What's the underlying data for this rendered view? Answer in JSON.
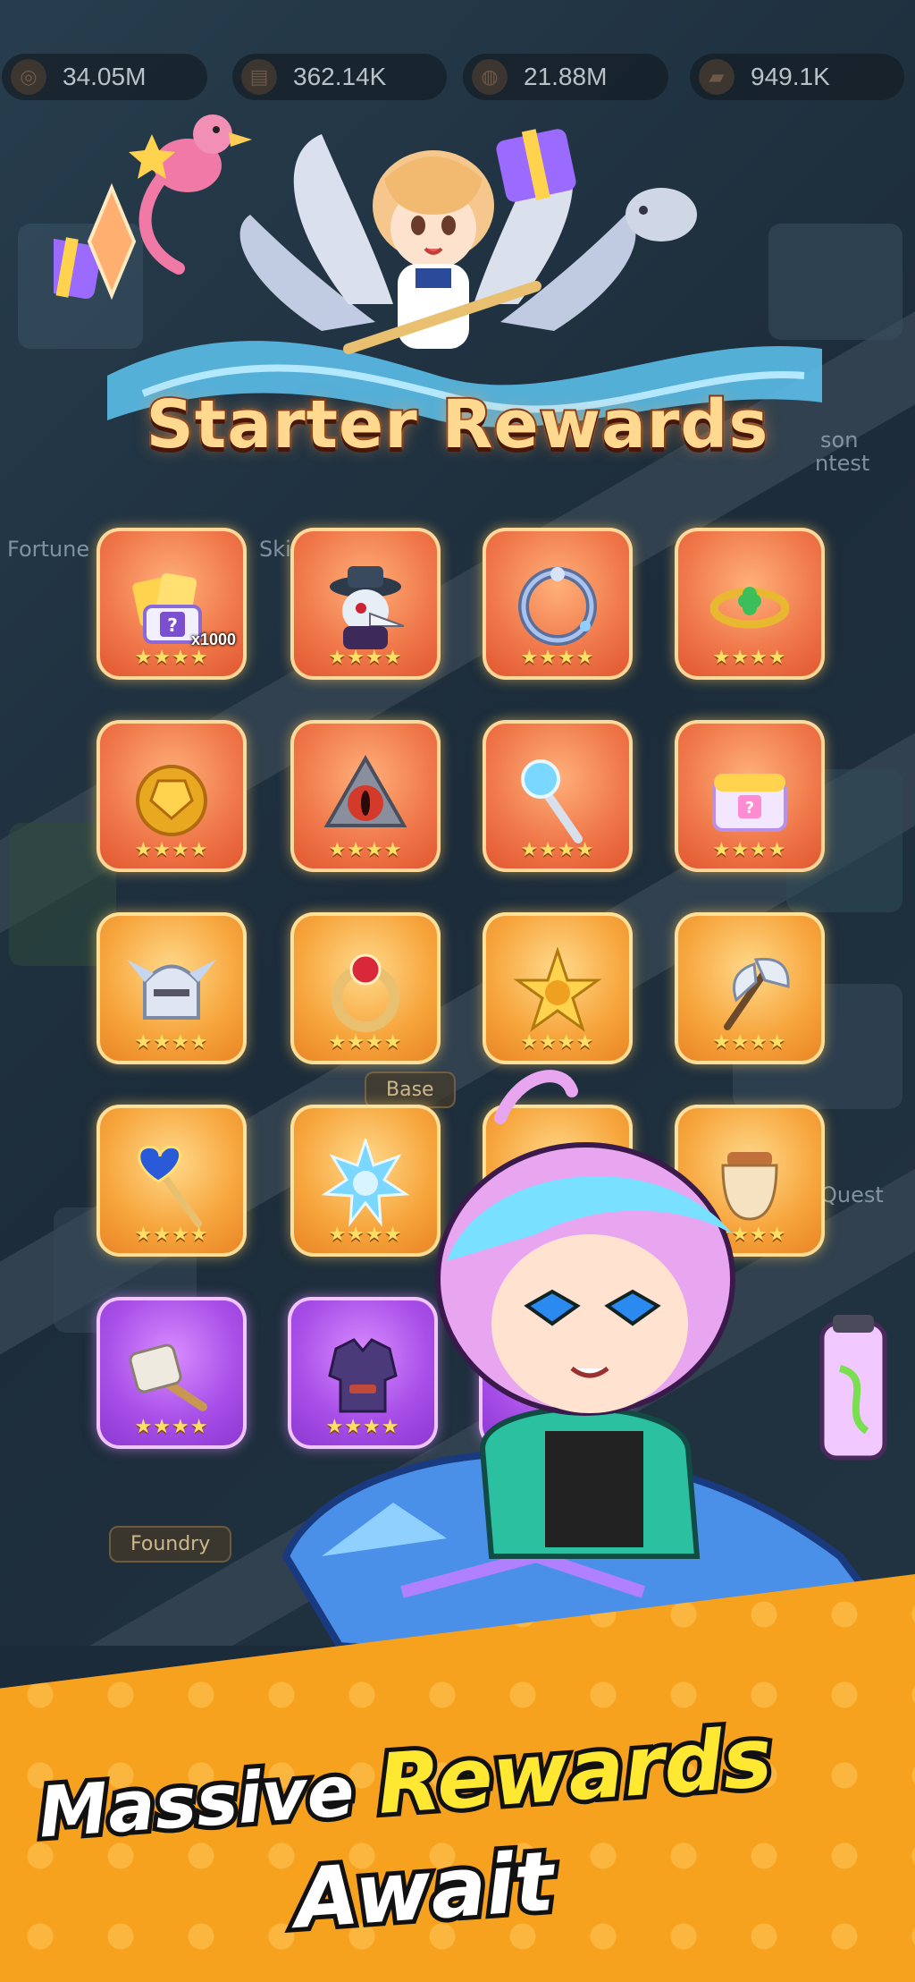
{
  "resources": [
    {
      "icon": "coin-icon",
      "value": "34.05M"
    },
    {
      "icon": "wood-icon",
      "value": "362.14K"
    },
    {
      "icon": "meat-icon",
      "value": "21.88M"
    },
    {
      "icon": "iron-icon",
      "value": "949.1K"
    }
  ],
  "background_labels": {
    "fortune": "Fortune",
    "skin": "Ski",
    "season": "son",
    "contest": "ntest",
    "base": "Base",
    "quest": "Quest",
    "foundry": "Foundry"
  },
  "banner": {
    "title": "Starter Rewards"
  },
  "rewards": [
    {
      "item": "mystery-chest-icon",
      "rarity": "orange",
      "stars": "★★★★",
      "qty": "x1000"
    },
    {
      "item": "plague-doctor-icon",
      "rarity": "orange",
      "stars": "★★★★",
      "qty": ""
    },
    {
      "item": "mech-ring-icon",
      "rarity": "orange",
      "stars": "★★★★",
      "qty": ""
    },
    {
      "item": "clover-bracelet-icon",
      "rarity": "orange",
      "stars": "★★★★",
      "qty": ""
    },
    {
      "item": "gold-orb-icon",
      "rarity": "orange",
      "stars": "★★★★",
      "qty": ""
    },
    {
      "item": "eye-emblem-icon",
      "rarity": "orange",
      "stars": "★★★★",
      "qty": ""
    },
    {
      "item": "crystal-staff-icon",
      "rarity": "orange",
      "stars": "★★★★",
      "qty": ""
    },
    {
      "item": "pink-chest-icon",
      "rarity": "orange",
      "stars": "★★★★",
      "qty": ""
    },
    {
      "item": "knight-helmet-icon",
      "rarity": "gold",
      "stars": "★★★★",
      "qty": ""
    },
    {
      "item": "ruby-ring-icon",
      "rarity": "gold",
      "stars": "★★★★",
      "qty": ""
    },
    {
      "item": "star-medal-icon",
      "rarity": "gold",
      "stars": "★★★★",
      "qty": ""
    },
    {
      "item": "battle-axe-icon",
      "rarity": "gold",
      "stars": "★★★★",
      "qty": ""
    },
    {
      "item": "heart-wand-icon",
      "rarity": "gold",
      "stars": "★★★★",
      "qty": ""
    },
    {
      "item": "ice-crystal-icon",
      "rarity": "gold",
      "stars": "★★★★",
      "qty": ""
    },
    {
      "item": "fire-pot-icon",
      "rarity": "gold",
      "stars": "★★★★",
      "qty": ""
    },
    {
      "item": "clay-jar-icon",
      "rarity": "gold",
      "stars": "★★★★",
      "qty": ""
    },
    {
      "item": "stone-hammer-icon",
      "rarity": "purple",
      "stars": "★★★★",
      "qty": ""
    },
    {
      "item": "armor-vest-icon",
      "rarity": "purple",
      "stars": "★★★★",
      "qty": ""
    },
    {
      "item": "purple-item-icon",
      "rarity": "purple",
      "stars": "★★★★",
      "qty": ""
    }
  ],
  "tagline": {
    "part1": "Massive ",
    "highlight": "Rewards",
    "part2": "Await"
  },
  "colors": {
    "orange_card": "#f0784a",
    "gold_card": "#f7a63e",
    "purple_card": "#a84fe8",
    "band": "#f7a21e",
    "highlight": "#ffe832"
  }
}
